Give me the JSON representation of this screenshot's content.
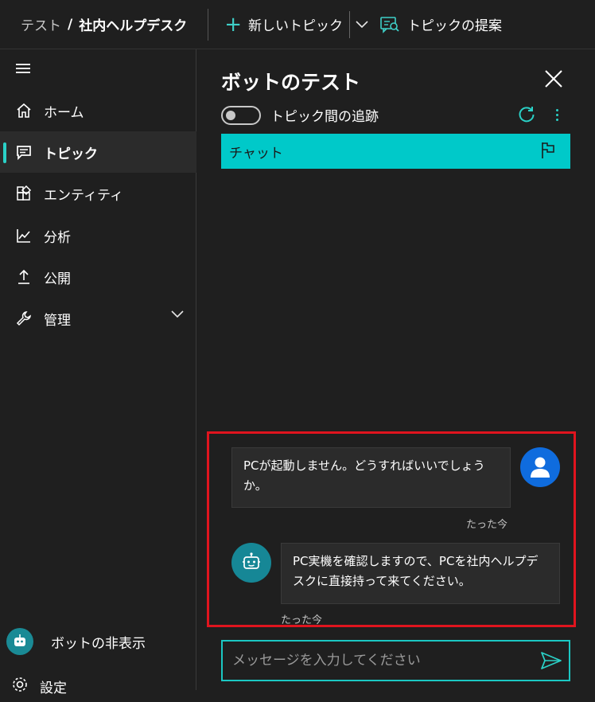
{
  "topbar": {
    "breadcrumb_parent": "テスト",
    "breadcrumb_sep": "/",
    "breadcrumb_current": "社内ヘルプデスク",
    "new_topic_label": "新しいトピック",
    "suggest_topic_label": "トピックの提案"
  },
  "sidebar": {
    "items": [
      {
        "label": "ホーム",
        "icon": "home-icon"
      },
      {
        "label": "トピック",
        "icon": "chat-icon",
        "active": true
      },
      {
        "label": "エンティティ",
        "icon": "entity-icon"
      },
      {
        "label": "分析",
        "icon": "chart-icon"
      },
      {
        "label": "公開",
        "icon": "upload-icon"
      },
      {
        "label": "管理",
        "icon": "wrench-icon"
      }
    ],
    "hide_bot_label": "ボットの非表示",
    "settings_label": "設定"
  },
  "panel": {
    "title": "ボットのテスト",
    "tracking_label": "トピック間の追跡",
    "tracking_on": false,
    "chat_tab_label": "チャット",
    "messages": [
      {
        "from": "user",
        "text": "PCが起動しません。どうすればいいでしょうか。",
        "time": "たった今"
      },
      {
        "from": "bot",
        "text": "PC実機を確認しますので、PCを社内ヘルプデスクに直接持って来てください。",
        "time": "たった今"
      }
    ],
    "input_placeholder": "メッセージを入力してください",
    "input_value": ""
  },
  "colors": {
    "accent": "#2ad1c7",
    "chat_tab": "#00c9c9",
    "highlight": "#e0141e",
    "user_avatar": "#0f6cde",
    "bot_avatar": "#168796"
  }
}
